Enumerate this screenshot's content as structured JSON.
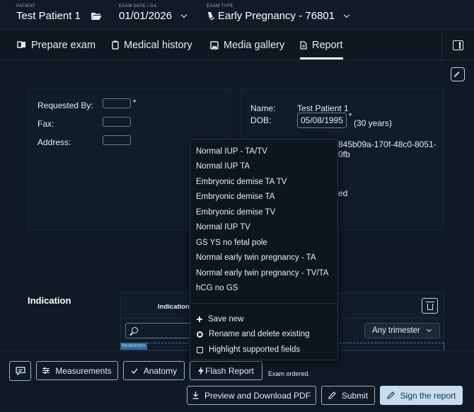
{
  "header": {
    "patient": {
      "caption": "PATIENT",
      "value": "Test Patient 1"
    },
    "exam_date": {
      "caption": "EXAM DATE / GA",
      "value": "01/01/2026"
    },
    "exam_type": {
      "caption": "EXAM TYPE",
      "value": "Early Pregnancy - 76801"
    }
  },
  "tabs": [
    {
      "label": "Prepare exam",
      "icon": "book-icon"
    },
    {
      "label": "Medical history",
      "icon": "clipboard-icon"
    },
    {
      "label": "Media gallery",
      "icon": "image-icon"
    },
    {
      "label": "Report",
      "icon": "document-icon",
      "active": true
    }
  ],
  "referral": {
    "requested_by_label": "Requested By:",
    "fax_label": "Fax:",
    "address_label": "Address:",
    "required_mark": "*"
  },
  "patient_info": {
    "name_label": "Name:",
    "name_value": "Test Patient 1",
    "dob_label": "DOB:",
    "dob_value": "05/08/1995",
    "required_mark": "*",
    "age_text": "(30 years)",
    "id_fragment_1": "845b09a-170f-48c0-8051-",
    "id_fragment_2": "0fb",
    "status_fragment": "ed"
  },
  "indication": {
    "section_title": "Indication",
    "column_label": "Indication",
    "required_mark": "*",
    "trimester_value": "Any trimester",
    "reserved_tag": "RESERVED"
  },
  "dropdown": {
    "items": [
      "Normal IUP - TA/TV",
      "Normal IUP TA",
      "Embryonic demise TA TV",
      "Embryonic demise TA",
      "Embryonic demise TV",
      "Normal IUP TV",
      "GS YS no fetal pole",
      "Normal early twin pregnancy - TA",
      "Normal early twin pregnancy - TV/TA",
      "hCG no GS"
    ],
    "actions": {
      "save_new": "Save new",
      "rename_delete": "Rename and delete existing",
      "highlight": "Highlight supported fields"
    }
  },
  "footer": {
    "measurements": "Measurements",
    "anatomy": "Anatomy",
    "flash_report": "Flash Report",
    "status": "Exam ordered.",
    "preview_pdf": "Preview and Download PDF",
    "submit": "Submit",
    "sign": "Sign the report"
  }
}
